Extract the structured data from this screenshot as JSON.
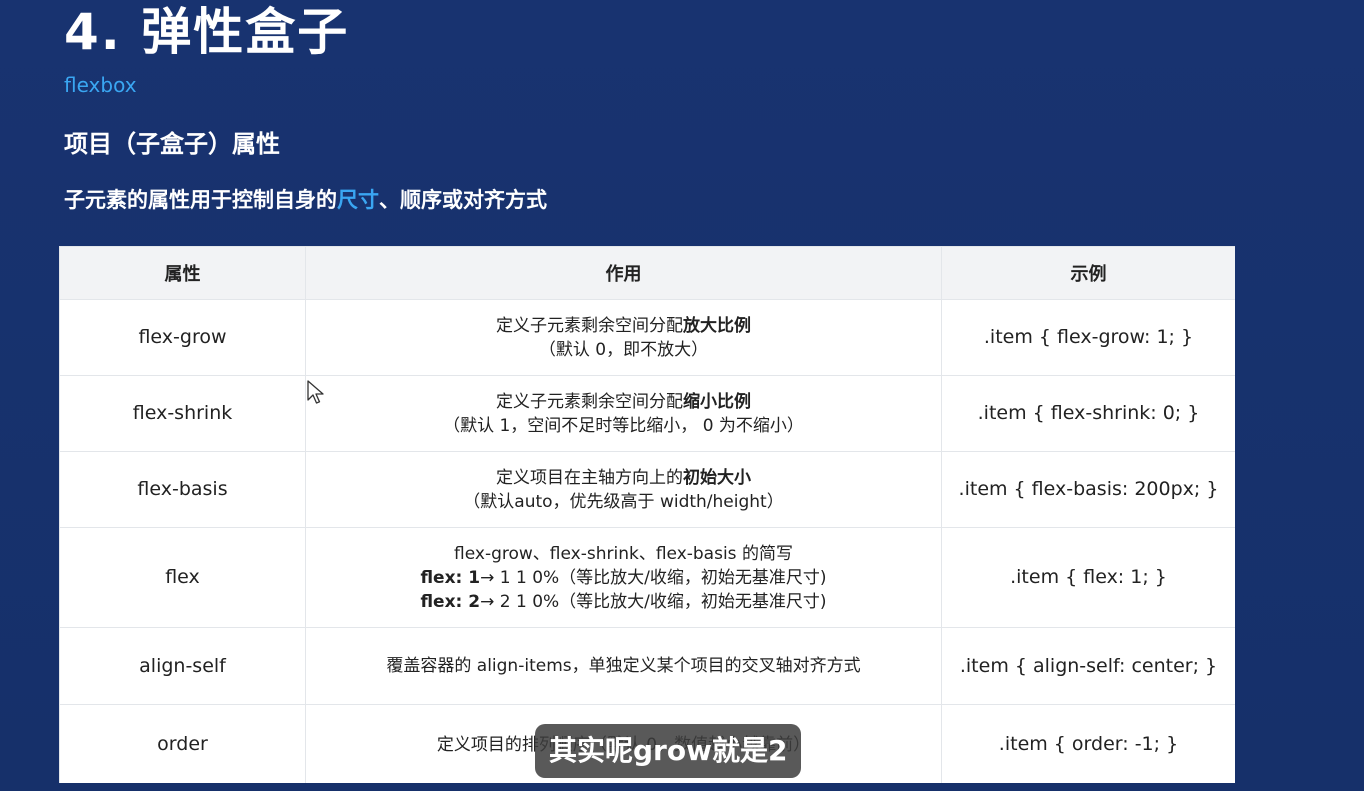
{
  "slide": {
    "title": "4. 弹性盒子",
    "subtitle": "flexbox",
    "section_title": "项目（子盒子）属性",
    "description_before": "子元素的属性用于控制自身的",
    "description_highlight": "尺寸",
    "description_after": "、顺序或对齐方式"
  },
  "table": {
    "headers": [
      "属性",
      "作用",
      "示例"
    ],
    "rows": [
      {
        "property": "flex-grow",
        "effect_line1_plain": "定义子元素剩余空间分配",
        "effect_line1_bold": "放大比例",
        "effect_line2": "（默认 0，即不放大）",
        "example": ".item { flex-grow: 1; }"
      },
      {
        "property": "flex-shrink",
        "effect_line1_plain": "定义子元素剩余空间分配",
        "effect_line1_bold": "缩小比例",
        "effect_line2": "（默认 1，空间不足时等比缩小， 0 为不缩小）",
        "example": ".item { flex-shrink: 0; }"
      },
      {
        "property": "flex-basis",
        "effect_line1_plain": "定义项目在主轴方向上的",
        "effect_line1_bold": "初始大小",
        "effect_line2": "（默认auto，优先级高于 width/height）",
        "example": ".item { flex-basis: 200px; }"
      },
      {
        "property": "flex",
        "effect_line1": "flex-grow、flex-shrink、flex-basis 的简写",
        "effect_line2_bold": "flex: 1",
        "effect_line2_plain": "→ 1 1 0%（等比放大/收缩，初始无基准尺寸)",
        "effect_line3_bold": "flex: 2",
        "effect_line3_plain": "→ 2 1 0%（等比放大/收缩，初始无基准尺寸)",
        "example": ".item { flex: 1; }"
      },
      {
        "property": "align-self",
        "effect_line1": "覆盖容器的 align-items，单独定义某个项目的交叉轴对齐方式",
        "example": ".item { align-self: center; }"
      },
      {
        "property": "order",
        "effect_line1": "定义项目的排列顺序（默认 0，数值越小越靠前）",
        "example": ".item { order: -1; }"
      }
    ]
  },
  "caption": "其实呢grow就是2",
  "icons": {
    "cursor": "mouse-pointer-icon"
  },
  "colors": {
    "background": "#17306b",
    "accent": "#3aa6f2",
    "table_header": "#f2f3f5"
  }
}
